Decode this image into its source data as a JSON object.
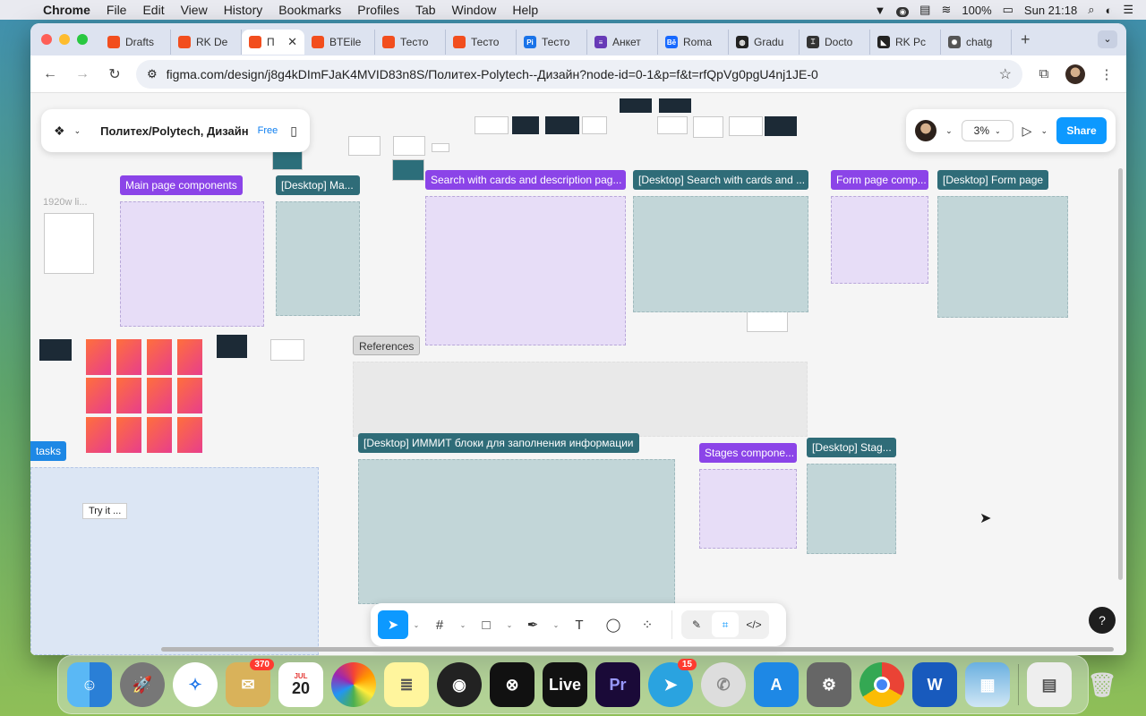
{
  "menubar": {
    "app_name": "Chrome",
    "items": [
      "File",
      "Edit",
      "View",
      "History",
      "Bookmarks",
      "Profiles",
      "Tab",
      "Window",
      "Help"
    ],
    "battery": "100%",
    "clock": "Sun 21:18"
  },
  "tabs": [
    {
      "label": "Drafts",
      "color": "#f24e1e"
    },
    {
      "label": "RK De",
      "color": "#f24e1e"
    },
    {
      "label": "П",
      "color": "#f24e1e",
      "active": true
    },
    {
      "label": "BTEile",
      "color": "#f24e1e"
    },
    {
      "label": "Тесто",
      "color": "#f24e1e"
    },
    {
      "label": "Тесто",
      "color": "#f24e1e"
    },
    {
      "label": "Тесто",
      "color": "#1a73e8"
    },
    {
      "label": "Анкет",
      "color": "#673ab7"
    },
    {
      "label": "Roma",
      "color": "#1769ff"
    },
    {
      "label": "Gradu",
      "color": "#222222"
    },
    {
      "label": "Docto",
      "color": "#333333"
    },
    {
      "label": "RK Pc",
      "color": "#222222"
    },
    {
      "label": "chatg",
      "color": "#555555"
    }
  ],
  "toolbar": {
    "url": "figma.com/design/j8g4kDImFJaK4MVID83n8S/Политех-Polytech--Дизайн?node-id=0-1&p=f&t=rfQpVg0pgU4nj1JE-0"
  },
  "figma": {
    "file_title": "Политех/Polytech, Дизайн",
    "plan_badge": "Free",
    "zoom": "3%",
    "share_label": "Share",
    "help_label": "?",
    "try_it": "Try it ...",
    "label_1920": "1920w li..."
  },
  "frames": {
    "main_page_components": "Main page components",
    "desktop_main": "[Desktop] Ma...",
    "search_cards": "Search with cards and description pag...",
    "desktop_search_cards": "[Desktop] Search with cards and ...",
    "form_page_components": "Form page comp...",
    "desktop_form": "[Desktop] Form page",
    "references": "References",
    "desktop_immit": "[Desktop] ИММИТ блоки для заполнения информации",
    "stages_components": "Stages compone...",
    "desktop_stages": "[Desktop] Stag...",
    "tasks": "tasks"
  },
  "dock": {
    "mail_badge": "370",
    "calendar_month": "JUL",
    "calendar_day": "20",
    "telegram_badge": "15",
    "live_label": "Live",
    "premiere_label": "Pr"
  }
}
